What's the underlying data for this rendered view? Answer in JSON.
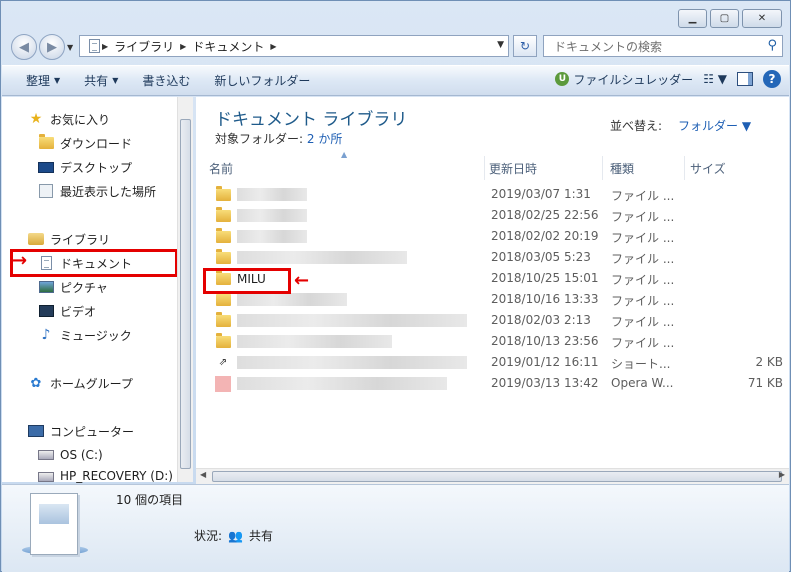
{
  "address": {
    "segments": [
      "ライブラリ",
      "ドキュメント"
    ]
  },
  "search": {
    "placeholder": "ドキュメントの検索"
  },
  "toolbar": {
    "organize": "整理",
    "share": "共有",
    "burn": "書き込む",
    "new_folder": "新しいフォルダー",
    "shredder": "ファイルシュレッダー"
  },
  "nav": {
    "favorites": "お気に入り",
    "downloads": "ダウンロード",
    "desktop": "デスクトップ",
    "recent": "最近表示した場所",
    "libraries": "ライブラリ",
    "documents": "ドキュメント",
    "pictures": "ピクチャ",
    "videos": "ビデオ",
    "music": "ミュージック",
    "homegroup": "ホームグループ",
    "computer": "コンピューター",
    "os": "OS (C:)",
    "recovery": "HP_RECOVERY (D:)"
  },
  "content": {
    "title": "ドキュメント ライブラリ",
    "subtitle_prefix": "対象フォルダー:",
    "subtitle_link": "2 か所",
    "sort_label": "並べ替え:",
    "sort_value": "フォルダー"
  },
  "columns": {
    "name": "名前",
    "date": "更新日時",
    "type": "種類",
    "size": "サイズ"
  },
  "files": [
    {
      "name": "",
      "date": "2019/03/07 1:31",
      "type": "ファイル ...",
      "size": ""
    },
    {
      "name": "",
      "date": "2018/02/25 22:56",
      "type": "ファイル ...",
      "size": ""
    },
    {
      "name": "",
      "date": "2018/02/02 20:19",
      "type": "ファイル ...",
      "size": ""
    },
    {
      "name": "",
      "date": "2018/03/05 5:23",
      "type": "ファイル ...",
      "size": ""
    },
    {
      "name": "MILU",
      "date": "2018/10/25 15:01",
      "type": "ファイル ...",
      "size": ""
    },
    {
      "name": "",
      "date": "2018/10/16 13:33",
      "type": "ファイル ...",
      "size": ""
    },
    {
      "name": "",
      "date": "2018/02/03 2:13",
      "type": "ファイル ...",
      "size": ""
    },
    {
      "name": "",
      "date": "2018/10/13 23:56",
      "type": "ファイル ...",
      "size": ""
    },
    {
      "name": "",
      "date": "2019/01/12 16:11",
      "type": "ショート...",
      "size": "2 KB"
    },
    {
      "name": "",
      "date": "2019/03/13 13:42",
      "type": "Opera W...",
      "size": "71 KB"
    }
  ],
  "details": {
    "count": "10 個の項目",
    "status_label": "状況:",
    "status_value": "共有"
  },
  "colors": {
    "highlight": "#e40000",
    "title": "#1e5a8a",
    "link": "#1e5fb4"
  }
}
